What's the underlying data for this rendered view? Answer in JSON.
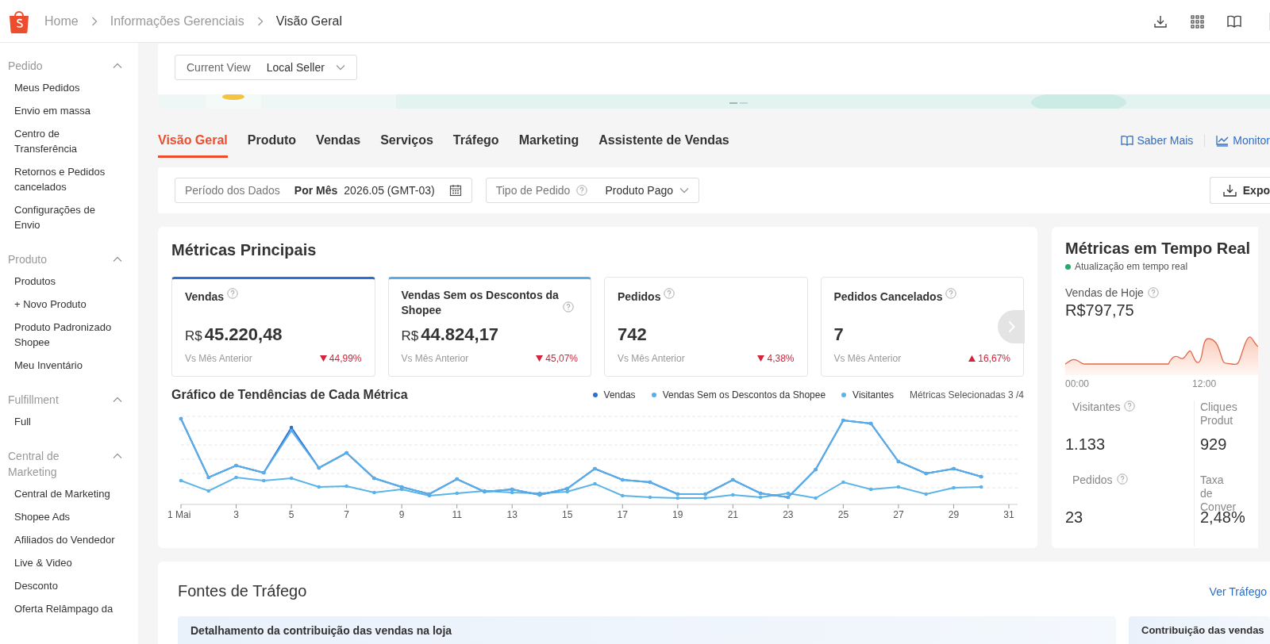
{
  "header": {
    "breadcrumb": [
      "Home",
      "Informações Gerenciais",
      "Visão Geral"
    ]
  },
  "sidebar": {
    "groups": [
      {
        "title": "Pedido",
        "expanded": true,
        "items": [
          "Meus Pedidos",
          "Envio em massa",
          "Centro de Transferência",
          "Retornos e Pedidos cancelados",
          "Configurações de Envio"
        ]
      },
      {
        "title": "Produto",
        "expanded": true,
        "items": [
          "Produtos",
          "+ Novo Produto",
          "Produto Padronizado Shopee",
          "Meu Inventário"
        ]
      },
      {
        "title": "Fulfillment",
        "expanded": true,
        "items": [
          "Full"
        ]
      },
      {
        "title": "Central de Marketing",
        "expanded": true,
        "items": [
          "Central de Marketing",
          "Shopee Ads",
          "Afiliados do Vendedor",
          "Live & Video",
          "Desconto",
          "Oferta Relâmpago da"
        ]
      }
    ]
  },
  "view_selector": {
    "label": "Current View",
    "value": "Local Seller"
  },
  "tabs": [
    {
      "label": "Visão Geral",
      "selected": true
    },
    {
      "label": "Produto",
      "selected": false
    },
    {
      "label": "Vendas",
      "selected": false
    },
    {
      "label": "Serviços",
      "selected": false
    },
    {
      "label": "Tráfego",
      "selected": false
    },
    {
      "label": "Marketing",
      "selected": false
    },
    {
      "label": "Assistente de Vendas",
      "selected": false
    }
  ],
  "header_links": [
    "Saber Mais",
    "Monitor"
  ],
  "filters": {
    "period": {
      "label": "Período dos Dados",
      "mode": "Por Mês",
      "value": "2026.05 (GMT-03)"
    },
    "order_type": {
      "label": "Tipo de Pedido",
      "value": "Produto Pago"
    },
    "export_button": "Expo"
  },
  "key_metrics": {
    "title": "Métricas Principais",
    "cards": [
      {
        "label": "Vendas",
        "currency": "R$",
        "value": "45.220,48",
        "comparison": "Vs Mês Anterior",
        "change": "44,99%",
        "decreased": true,
        "selected": true,
        "color": "#2a6fd1"
      },
      {
        "label": "Vendas Sem os Descontos da Shopee",
        "currency": "R$",
        "value": "44.824,17",
        "comparison": "Vs Mês Anterior",
        "change": "45,07%",
        "decreased": true,
        "selected": true,
        "color": "#5aaee8"
      },
      {
        "label": "Pedidos",
        "value": "742",
        "comparison": "Vs Mês Anterior",
        "change": "4,38%",
        "decreased": true,
        "selected": false
      },
      {
        "label": "Pedidos Cancelados",
        "value": "7",
        "comparison": "Vs Mês Anterior",
        "change": "16,67%",
        "decreased": false,
        "selected": false
      }
    ]
  },
  "trend_chart": {
    "title": "Gráfico de Tendências de Cada Métrica",
    "legend": [
      {
        "name": "Vendas",
        "color": "#2a6fd1"
      },
      {
        "name": "Vendas Sem os Descontos da Shopee",
        "color": "#5aaee8"
      },
      {
        "name": "Visitantes",
        "color": "#5ab4e8"
      }
    ],
    "selection_count": "Métricas Selecionadas 3 /4",
    "x_labels": [
      "1 Mai",
      "3",
      "5",
      "7",
      "9",
      "11",
      "13",
      "15",
      "17",
      "19",
      "21",
      "23",
      "25",
      "27",
      "29",
      "31"
    ]
  },
  "realtime": {
    "title": "Métricas em Tempo Real",
    "status": "Atualização em tempo real",
    "sales_label": "Vendas de Hoje",
    "sales_value": "R$797,75",
    "time_labels": [
      "00:00",
      "12:00"
    ],
    "metrics": [
      {
        "label": "Visitantes",
        "value": "1.133",
        "help": true
      },
      {
        "label": "Cliques Produt",
        "value": "929",
        "help": false
      },
      {
        "label": "Pedidos",
        "value": "23",
        "help": true
      },
      {
        "label": "Taxa de Conver",
        "value": "2,48%",
        "help": false
      }
    ]
  },
  "traffic": {
    "title": "Fontes de Tráfego",
    "link": "Ver Tráfego",
    "panels": [
      "Detalhamento da contribuição das vendas na loja",
      "Contribuição das vendas"
    ]
  }
}
